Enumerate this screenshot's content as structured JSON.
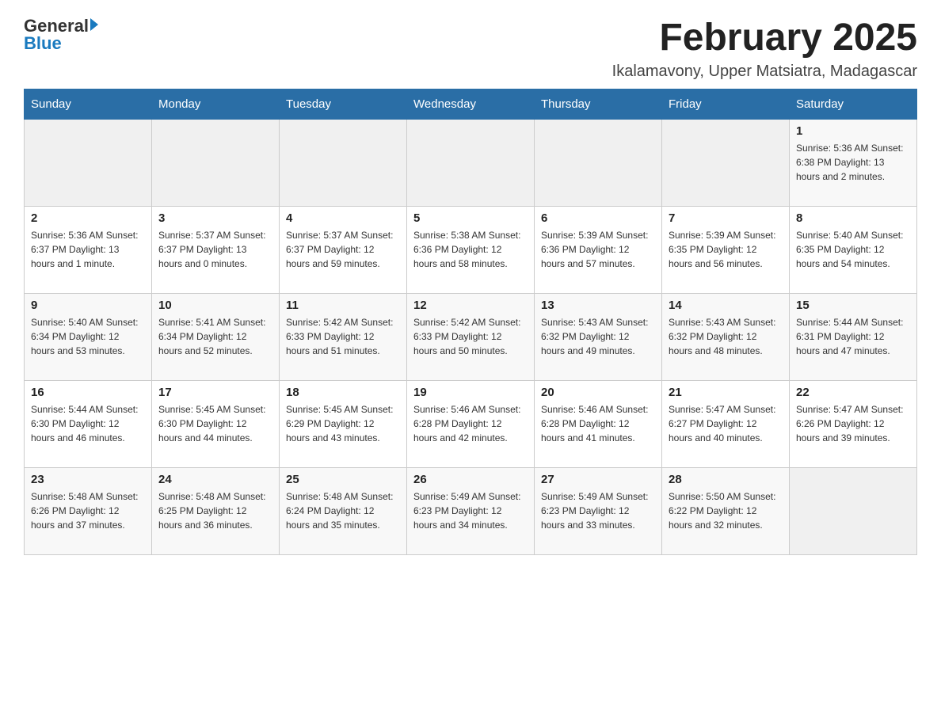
{
  "header": {
    "logo_general": "General",
    "logo_blue": "Blue",
    "month_title": "February 2025",
    "location": "Ikalamavony, Upper Matsiatra, Madagascar"
  },
  "days_of_week": [
    "Sunday",
    "Monday",
    "Tuesday",
    "Wednesday",
    "Thursday",
    "Friday",
    "Saturday"
  ],
  "weeks": [
    [
      {
        "day": "",
        "info": ""
      },
      {
        "day": "",
        "info": ""
      },
      {
        "day": "",
        "info": ""
      },
      {
        "day": "",
        "info": ""
      },
      {
        "day": "",
        "info": ""
      },
      {
        "day": "",
        "info": ""
      },
      {
        "day": "1",
        "info": "Sunrise: 5:36 AM\nSunset: 6:38 PM\nDaylight: 13 hours and 2 minutes."
      }
    ],
    [
      {
        "day": "2",
        "info": "Sunrise: 5:36 AM\nSunset: 6:37 PM\nDaylight: 13 hours and 1 minute."
      },
      {
        "day": "3",
        "info": "Sunrise: 5:37 AM\nSunset: 6:37 PM\nDaylight: 13 hours and 0 minutes."
      },
      {
        "day": "4",
        "info": "Sunrise: 5:37 AM\nSunset: 6:37 PM\nDaylight: 12 hours and 59 minutes."
      },
      {
        "day": "5",
        "info": "Sunrise: 5:38 AM\nSunset: 6:36 PM\nDaylight: 12 hours and 58 minutes."
      },
      {
        "day": "6",
        "info": "Sunrise: 5:39 AM\nSunset: 6:36 PM\nDaylight: 12 hours and 57 minutes."
      },
      {
        "day": "7",
        "info": "Sunrise: 5:39 AM\nSunset: 6:35 PM\nDaylight: 12 hours and 56 minutes."
      },
      {
        "day": "8",
        "info": "Sunrise: 5:40 AM\nSunset: 6:35 PM\nDaylight: 12 hours and 54 minutes."
      }
    ],
    [
      {
        "day": "9",
        "info": "Sunrise: 5:40 AM\nSunset: 6:34 PM\nDaylight: 12 hours and 53 minutes."
      },
      {
        "day": "10",
        "info": "Sunrise: 5:41 AM\nSunset: 6:34 PM\nDaylight: 12 hours and 52 minutes."
      },
      {
        "day": "11",
        "info": "Sunrise: 5:42 AM\nSunset: 6:33 PM\nDaylight: 12 hours and 51 minutes."
      },
      {
        "day": "12",
        "info": "Sunrise: 5:42 AM\nSunset: 6:33 PM\nDaylight: 12 hours and 50 minutes."
      },
      {
        "day": "13",
        "info": "Sunrise: 5:43 AM\nSunset: 6:32 PM\nDaylight: 12 hours and 49 minutes."
      },
      {
        "day": "14",
        "info": "Sunrise: 5:43 AM\nSunset: 6:32 PM\nDaylight: 12 hours and 48 minutes."
      },
      {
        "day": "15",
        "info": "Sunrise: 5:44 AM\nSunset: 6:31 PM\nDaylight: 12 hours and 47 minutes."
      }
    ],
    [
      {
        "day": "16",
        "info": "Sunrise: 5:44 AM\nSunset: 6:30 PM\nDaylight: 12 hours and 46 minutes."
      },
      {
        "day": "17",
        "info": "Sunrise: 5:45 AM\nSunset: 6:30 PM\nDaylight: 12 hours and 44 minutes."
      },
      {
        "day": "18",
        "info": "Sunrise: 5:45 AM\nSunset: 6:29 PM\nDaylight: 12 hours and 43 minutes."
      },
      {
        "day": "19",
        "info": "Sunrise: 5:46 AM\nSunset: 6:28 PM\nDaylight: 12 hours and 42 minutes."
      },
      {
        "day": "20",
        "info": "Sunrise: 5:46 AM\nSunset: 6:28 PM\nDaylight: 12 hours and 41 minutes."
      },
      {
        "day": "21",
        "info": "Sunrise: 5:47 AM\nSunset: 6:27 PM\nDaylight: 12 hours and 40 minutes."
      },
      {
        "day": "22",
        "info": "Sunrise: 5:47 AM\nSunset: 6:26 PM\nDaylight: 12 hours and 39 minutes."
      }
    ],
    [
      {
        "day": "23",
        "info": "Sunrise: 5:48 AM\nSunset: 6:26 PM\nDaylight: 12 hours and 37 minutes."
      },
      {
        "day": "24",
        "info": "Sunrise: 5:48 AM\nSunset: 6:25 PM\nDaylight: 12 hours and 36 minutes."
      },
      {
        "day": "25",
        "info": "Sunrise: 5:48 AM\nSunset: 6:24 PM\nDaylight: 12 hours and 35 minutes."
      },
      {
        "day": "26",
        "info": "Sunrise: 5:49 AM\nSunset: 6:23 PM\nDaylight: 12 hours and 34 minutes."
      },
      {
        "day": "27",
        "info": "Sunrise: 5:49 AM\nSunset: 6:23 PM\nDaylight: 12 hours and 33 minutes."
      },
      {
        "day": "28",
        "info": "Sunrise: 5:50 AM\nSunset: 6:22 PM\nDaylight: 12 hours and 32 minutes."
      },
      {
        "day": "",
        "info": ""
      }
    ]
  ]
}
